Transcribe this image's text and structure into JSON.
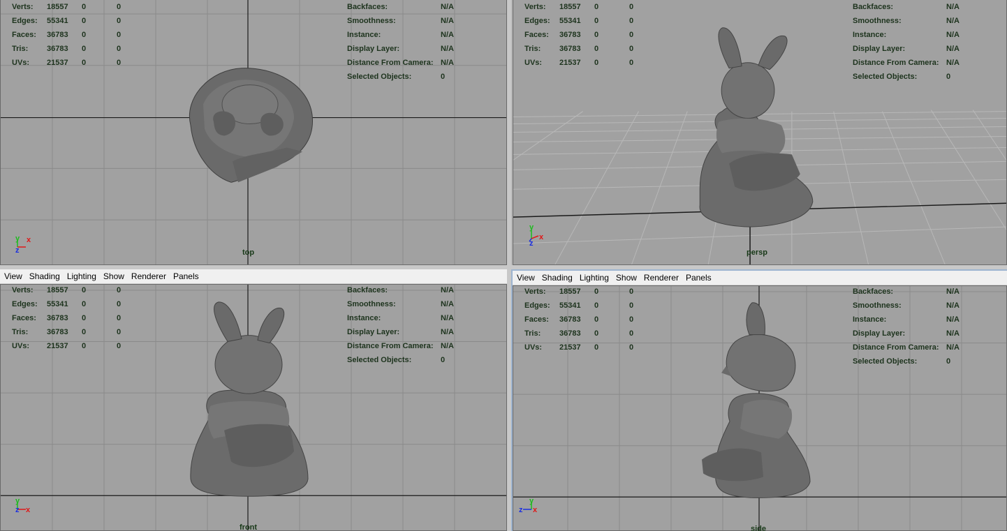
{
  "menus": [
    "View",
    "Shading",
    "Lighting",
    "Show",
    "Renderer",
    "Panels"
  ],
  "hud_left": {
    "rows": [
      {
        "label": "Verts:",
        "v1": "18557",
        "v2": "0",
        "v3": "0"
      },
      {
        "label": "Edges:",
        "v1": "55341",
        "v2": "0",
        "v3": "0"
      },
      {
        "label": "Faces:",
        "v1": "36783",
        "v2": "0",
        "v3": "0"
      },
      {
        "label": "Tris:",
        "v1": "36783",
        "v2": "0",
        "v3": "0"
      },
      {
        "label": "UVs:",
        "v1": "21537",
        "v2": "0",
        "v3": "0"
      }
    ]
  },
  "hud_right": {
    "rows": [
      {
        "label": "Backfaces:",
        "value": "N/A"
      },
      {
        "label": "Smoothness:",
        "value": "N/A"
      },
      {
        "label": "Instance:",
        "value": "N/A"
      },
      {
        "label": "Display Layer:",
        "value": "N/A"
      },
      {
        "label": "Distance From Camera:",
        "value": "N/A"
      },
      {
        "label": "Selected Objects:",
        "value": "0"
      }
    ]
  },
  "viewports": {
    "top": {
      "camera": "top"
    },
    "persp": {
      "camera": "persp"
    },
    "front": {
      "camera": "front"
    },
    "side": {
      "camera": "side"
    }
  },
  "axes": {
    "top": [
      "y",
      "x",
      "z"
    ],
    "persp": [
      "y",
      "x",
      "z"
    ],
    "front": [
      "y",
      "x",
      "z"
    ],
    "side": [
      "y",
      "x",
      "z"
    ]
  },
  "colors": {
    "viewport_bg": "#a1a1a1",
    "grid_line": "#8a8a8a",
    "axis_line": "#1a1a1a",
    "hud_text": "#1d331d",
    "axis_y": "#1cbc1c",
    "axis_x": "#e01818",
    "axis_z": "#1a2ee0",
    "model": "#6e6e6e"
  },
  "icons": {
    "view_axis": "view-axis-icon",
    "model": "bunny-model-icon"
  }
}
